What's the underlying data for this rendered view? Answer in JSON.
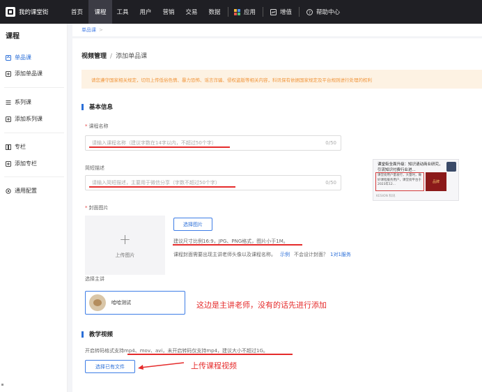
{
  "brand": {
    "name": "我的课堂街"
  },
  "nav": [
    {
      "label": "首页"
    },
    {
      "label": "课程"
    },
    {
      "label": "工具"
    },
    {
      "label": "用户"
    },
    {
      "label": "营销"
    },
    {
      "label": "交易"
    },
    {
      "label": "数据"
    }
  ],
  "nav_right": [
    {
      "label": "应用",
      "icon": "app-icon"
    },
    {
      "label": "增值",
      "icon": "addon-icon"
    },
    {
      "label": "帮助中心",
      "icon": "help-icon"
    }
  ],
  "sidebar": {
    "title": "课程",
    "items": [
      {
        "label": "单品课",
        "icon": "single-course-icon"
      },
      {
        "label": "添加单品课",
        "icon": "add-single-course-icon"
      },
      {
        "label": "系列课",
        "icon": "series-icon"
      },
      {
        "label": "添加系列课",
        "icon": "add-series-icon"
      },
      {
        "label": "专栏",
        "icon": "column-icon"
      },
      {
        "label": "添加专栏",
        "icon": "add-column-icon"
      },
      {
        "label": "通用配置",
        "icon": "settings-icon"
      }
    ]
  },
  "breadcrumb": {
    "item": "单品课",
    "sep": ">"
  },
  "page": {
    "title": "视频管理",
    "sep": "/",
    "current": "添加单品课"
  },
  "notice": "请您遵守国家相关规定，切勿上传低俗色情、暴力恐怖、谣言诈骗、侵权盗版等相关内容，科讯保有依据国家规定及平台规则进行处理的权利",
  "basic": {
    "section_title": "基本信息",
    "course_name": {
      "label": "课程名称",
      "placeholder": "请输入课程名称（建议字数在14字以内，不超过50个字）",
      "count": "0/50"
    },
    "summary": {
      "label": "简短描述",
      "placeholder": "请输入简短描述，主要用于微信分享（字数不超过50个字）",
      "count": "0/50"
    },
    "cover": {
      "label": "封面图片",
      "upload_label": "上传图片",
      "choose_btn": "选择图片",
      "hint1": "建议尺寸比例16:9，JPG、PNG格式，图片小于1M。",
      "hint2": "课程封面需要出现主讲老师头像以及课程名称。",
      "example_link": "示例",
      "no_design": "不会设计封面？",
      "service_link": "1对1服务"
    },
    "teacher": {
      "label": "选择主讲",
      "name": "哈哈测试"
    }
  },
  "preview": {
    "title": "课堂街全面升级：知识请动商业研究，引流知识付费行业进...",
    "box_text": "课堂街用户量发行，大量时，做好课程服务用户，课堂街平台于2023年12...",
    "image_text": "品牌",
    "footer": "KESION 科讯"
  },
  "video": {
    "section_title": "教学视频",
    "hint": "开启转码格式支持mp4、mov、avi，未开启转码仅支持mp4，建议大小不超过1G。",
    "choose_btn": "选择已有文件"
  },
  "annotations": {
    "teacher_note": "这边是主讲老师，没有的话先进行添加",
    "video_note": "上传课程视频",
    "color": "#e52b2b"
  },
  "colors": {
    "accent": "#2b6fd8",
    "nav_bg": "#1f1f24",
    "notice_bg": "#fdf2e3",
    "notice_text": "#f0953b"
  }
}
